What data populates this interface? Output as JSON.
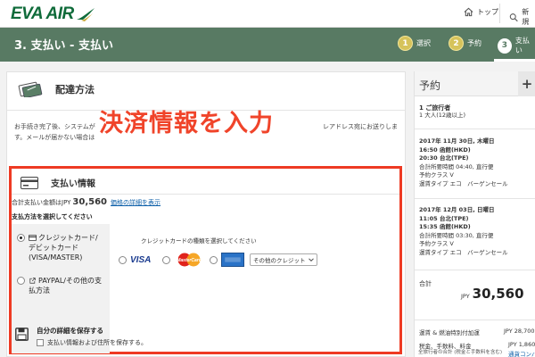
{
  "colors": {
    "brand_green": "#0f6b3a",
    "stepbar": "#587a63",
    "highlight_red": "#ee3a23",
    "caption_red": "#f0442a",
    "link_blue": "#0b5ea8"
  },
  "header": {
    "logo_text": "EVA AIR",
    "nav_top": "トップ",
    "nav_new": "新規"
  },
  "steps": {
    "title": "3. 支払い - 支払い",
    "items": [
      {
        "num": "1",
        "label": "選択"
      },
      {
        "num": "2",
        "label": "予約"
      },
      {
        "num": "3",
        "label": "支払い"
      }
    ]
  },
  "delivery": {
    "title": "配達方法",
    "line_a": "お手続き完了後、システムが",
    "line_b": "レアドレス宛にお送りしま",
    "line_c": "す。メールが届かない場合は"
  },
  "overlay_caption": "決済情報を入力",
  "payment": {
    "title": "支払い情報",
    "amount_prefix": "合計支払い金額は",
    "amount_currency": "JPY",
    "amount_value": "30,560",
    "amount_link": "価格の詳細を表示",
    "method_label": "支払方法を選択してください",
    "methods": [
      {
        "label_1": "クレジットカード/",
        "label_2": "デビットカード",
        "label_3": "(VISA/MASTER)"
      },
      {
        "label_1": "PAYPAL/その他の支",
        "label_2": "払方法"
      }
    ],
    "cc_type_label": "クレジットカードの種類を選択してください",
    "cc_brands": [
      "VISA",
      "MasterCard",
      "AMERICAN EXPRESS"
    ],
    "other_select": "その他のクレジット",
    "save_title": "自分の詳細を保存する",
    "save_checkbox": "支払い情報および住所を保存する。"
  },
  "summary": {
    "title": "予約",
    "plus": "+",
    "pax_line_1": "1 ご旅行者",
    "pax_line_2": "1 大人(12歳以上)",
    "segments": [
      {
        "date": "2017年 11月 30日, 木曜日",
        "dep": "16:50 函館(HKD)",
        "arr": "20:30 台北(TPE)",
        "duration": "合計所要時間 04:40, 直行便",
        "class": "予約クラス V",
        "fare": "運賃タイプ エコ　バーゲンセール"
      },
      {
        "date": "2017年 12月 03日, 日曜日",
        "dep": "11:05 台北(TPE)",
        "arr": "15:35 函館(HKD)",
        "duration": "合計所要時間 03:30, 直行便",
        "class": "予約クラス V",
        "fare": "運賃タイプ エコ　バーゲンセール"
      }
    ],
    "total_label": "合計",
    "total_currency": "JPY",
    "total_value": "30,560",
    "fee_1_label": "運賃 & 燃油特別付加運",
    "fee_1_value": "JPY 28,700",
    "fee_2_label": "税金、手数料、料金",
    "fee_2_value": "JPY 1,860",
    "fee_link": "通貨コンバータ",
    "fee_note": "全旅行者の合計 (税金と手数料を含む)"
  }
}
